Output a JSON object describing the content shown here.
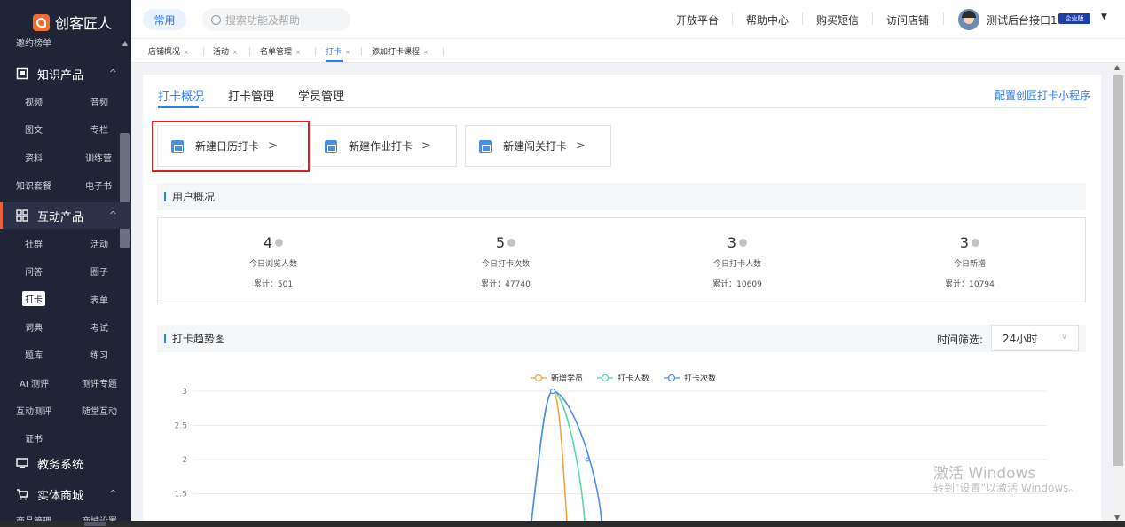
{
  "sidebar": {
    "brand": "创客匠人",
    "top_label": "邀约榜单",
    "sections": [
      {
        "label": "知识产品",
        "caret": "^"
      },
      {
        "label": "互动产品",
        "caret": "^"
      },
      {
        "label": "教务系统"
      },
      {
        "label": "实体商城",
        "caret": "^"
      }
    ],
    "knowledge_items": [
      "视频",
      "音频",
      "图文",
      "专栏",
      "资料",
      "训练营",
      "知识套餐",
      "电子书"
    ],
    "interactive_items": [
      "社群",
      "活动",
      "问答",
      "圈子",
      "打卡",
      "表单",
      "词典",
      "考试",
      "题库",
      "练习",
      "AI 测评",
      "测评专题",
      "互动测评",
      "随堂互动",
      "证书"
    ],
    "mall_items": [
      "商品管理",
      "商城设置"
    ]
  },
  "topbar": {
    "pill": "常用",
    "search_placeholder": "搜索功能及帮助",
    "links": [
      "开放平台",
      "帮助中心",
      "购买短信",
      "访问店铺"
    ],
    "user_name": "测试后台接口1",
    "vip_badge": "企业版",
    "user_caret": "▼"
  },
  "tabs": [
    {
      "label": "店铺概况",
      "close": "×"
    },
    {
      "label": "活动",
      "close": "×"
    },
    {
      "label": "名单管理",
      "close": "×"
    },
    {
      "label": "打卡",
      "close": "×"
    },
    {
      "label": "添加打卡课程",
      "close": "×"
    }
  ],
  "subtabs": [
    "打卡概况",
    "打卡管理",
    "学员管理"
  ],
  "config_link": "配置创匠打卡小程序",
  "create_buttons": [
    {
      "label": "新建日历打卡",
      "arrow": ">"
    },
    {
      "label": "新建作业打卡",
      "arrow": ">"
    },
    {
      "label": "新建闯关打卡",
      "arrow": ">"
    }
  ],
  "overview": {
    "title": "用户概况",
    "stats": [
      {
        "value": "4",
        "label": "今日浏览人数",
        "total": "累计：501"
      },
      {
        "value": "5",
        "label": "今日打卡次数",
        "total": "累计：47740"
      },
      {
        "value": "3",
        "label": "今日打卡人数",
        "total": "累计：10609"
      },
      {
        "value": "3",
        "label": "今日新增",
        "total": "累计：10794"
      }
    ]
  },
  "trend": {
    "title": "打卡趋势图",
    "filter_label": "时间筛选:",
    "filter_value": "24小时",
    "filter_chevron": "∨"
  },
  "chart_data": {
    "type": "line",
    "title": "",
    "series": [
      {
        "name": "新增学员",
        "color": "#f4a142"
      },
      {
        "name": "打卡人数",
        "color": "#5cd6a7"
      },
      {
        "name": "打卡次数",
        "color": "#4d8ef0"
      }
    ],
    "y_ticks": [
      "3",
      "2.5",
      "2",
      "1.5"
    ],
    "ylim": [
      1.5,
      3
    ],
    "peak_value": 3,
    "grid": true,
    "legend": "top-center"
  },
  "watermark": {
    "line1": "激活 Windows",
    "line2": "转到\"设置\"以激活 Windows。"
  },
  "colors": {
    "accent": "#2d7ff9",
    "sidebar": "#1f2436",
    "highlight_box": "#e02020"
  }
}
